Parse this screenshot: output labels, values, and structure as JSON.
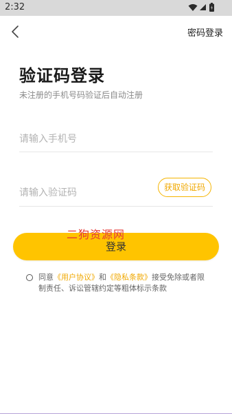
{
  "status_bar": {
    "time": "2:32"
  },
  "header": {
    "password_login_label": "密码登录"
  },
  "title": "验证码登录",
  "subtitle": "未注册的手机号码验证后自动注册",
  "phone_field": {
    "placeholder": "请输入手机号",
    "value": ""
  },
  "code_field": {
    "placeholder": "请输入验证码",
    "value": ""
  },
  "get_code_label": "获取验证码",
  "watermark": "二狗资源网",
  "login_label": "登录",
  "agreement": {
    "prefix": "同意",
    "user_agreement": "《用户协议》",
    "and": "和",
    "privacy_policy": "《隐私条款》",
    "suffix": "接受免除或者限制责任、诉讼管辖约定等粗体标示条款"
  },
  "colors": {
    "accent": "#ffc400",
    "link": "#f0a800",
    "watermark": "#e53935"
  }
}
